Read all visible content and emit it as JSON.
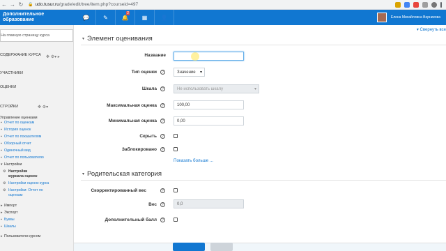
{
  "browser": {
    "url_host": "udo.tusur.ru",
    "url_path": "/grade/edit/tree/item.php?courseid=497"
  },
  "topbar": {
    "brand": "Дополнительное образование",
    "notification_count": "2",
    "user_name": "Елена Михайловна Верникова"
  },
  "sidebar": {
    "course_link": "На главную страницу курса",
    "content_header": "СОДЕРЖАНИЕ КУРСА",
    "participants": "УЧАСТНИКИ",
    "grades": "ОЦЕНКИ",
    "settings_header": "СТРОЙКИ",
    "grade_mgmt": "Управление оценками",
    "grade_items": [
      "Отчет по оценкам",
      "История оценок",
      "Отчет по показателям",
      "Обзорный отчет",
      "Одиночный вид",
      "Отчет по пользователю"
    ],
    "settings": "Настройки",
    "settings_items": [
      "Настройки журнала оценок",
      "Настройки оценок курса",
      "Настройки: Отчет по оценкам"
    ],
    "import": "Импорт",
    "export": "Экспорт",
    "letters": "Буквы",
    "scales": "Шкалы",
    "unenroll": "Пользователи курсом"
  },
  "main": {
    "collapse_all": "▾ Свернуть все",
    "section1_title": "Элемент оценивания",
    "section2_title": "Родительская категория",
    "name_label": "Название",
    "name_value": "",
    "grade_type_label": "Тип оценки",
    "grade_type_value": "Значение",
    "scale_label": "Шкала",
    "scale_value": "Не использовать шкалу",
    "max_grade_label": "Максимальная оценка",
    "max_grade_value": "100,00",
    "min_grade_label": "Минимальная оценка",
    "min_grade_value": "0,00",
    "hidden_label": "Скрыть",
    "locked_label": "Заблокировано",
    "show_more": "Показать больше ...",
    "adjusted_weight_label": "Скорректированный вес",
    "weight_label": "Вес",
    "weight_value": "0,0",
    "extra_credit_label": "Дополнительный балл"
  }
}
